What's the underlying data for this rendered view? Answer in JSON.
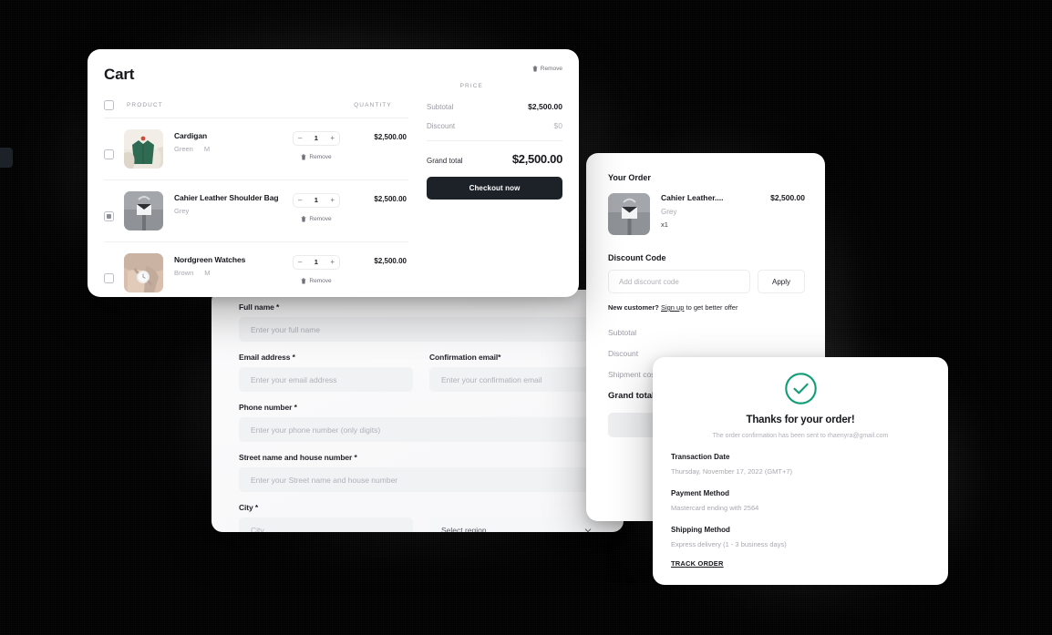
{
  "cart": {
    "title": "Cart",
    "remove_all_label": "Remove",
    "columns": {
      "select": "",
      "product": "PRODUCT",
      "quantity": "QUANTITY",
      "price": "PRICE"
    },
    "rows": [
      {
        "name": "Cardigan",
        "color": "Green",
        "size": "M",
        "qty": "1",
        "price": "$2,500.00",
        "selected": false,
        "remove_label": "Remove",
        "minus": "–",
        "plus": "+",
        "thumb": "cardigan-photo"
      },
      {
        "name": "Cahier Leather Shoulder Bag",
        "color": "Grey",
        "size": "",
        "qty": "1",
        "price": "$2,500.00",
        "selected": true,
        "remove_label": "Remove",
        "minus": "–",
        "plus": "+",
        "thumb": "bag-photo"
      },
      {
        "name": "Nordgreen Watches",
        "color": "Brown",
        "size": "M",
        "qty": "1",
        "price": "$2,500.00",
        "selected": false,
        "remove_label": "Remove",
        "minus": "–",
        "plus": "+",
        "thumb": "watch-photo"
      }
    ],
    "summary": {
      "subtotal_label": "Subtotal",
      "subtotal_value": "$2,500.00",
      "discount_label": "Discount",
      "discount_value": "$0",
      "grand_total_label": "Grand total",
      "grand_total_value": "$2,500.00",
      "checkout_label": "Checkout now"
    }
  },
  "checkout_form": {
    "fields": [
      {
        "label": "Full name *",
        "placeholder": "Enter your full name",
        "value": ""
      },
      {
        "label": "Email address *",
        "placeholder": "Enter your email address",
        "value": ""
      },
      {
        "label": "Confirmation email*",
        "placeholder": "Enter your confirmation email",
        "value": ""
      },
      {
        "label": "Phone number *",
        "placeholder": "Enter your phone number (only digits)",
        "value": ""
      },
      {
        "label": "Street name and house number *",
        "placeholder": "Enter your Street name and house number",
        "value": ""
      },
      {
        "label": "City *",
        "placeholder": "City",
        "value": ""
      }
    ],
    "region_select": {
      "selected": "Select region",
      "icon": "chevron-down-icon"
    }
  },
  "order": {
    "title": "Your Order",
    "item": {
      "name": "Cahier Leather....",
      "variant": "Grey",
      "quantity": "x1",
      "price": "$2,500.00",
      "thumb": "bag-photo"
    },
    "discount_code": {
      "title": "Discount Code",
      "placeholder": "Add discount code",
      "value": "",
      "apply_label": "Apply"
    },
    "new_customer": {
      "lead": "New customer?",
      "link": "Sign up",
      "tail": "to get better offer"
    },
    "summary": {
      "subtotal_label": "Subtotal",
      "discount_label": "Discount",
      "shipment_label": "Shipment cost",
      "grand_total_label": "Grand total"
    }
  },
  "confirmation": {
    "check_icon": "success-check-icon",
    "accent_color": "#0f9d76",
    "title": "Thanks for your order!",
    "subtitle": "The order confirmation has been sent to rhaenyra@gmail.com",
    "blocks": [
      {
        "label": "Transaction Date",
        "value": "Thursday, November 17, 2022 (GMT+7)"
      },
      {
        "label": "Payment Method",
        "value": "Mastercard ending with 2564"
      },
      {
        "label": "Shipping Method",
        "value": "Express delivery (1 - 3 business days)"
      }
    ],
    "track_label": "TRACK ORDER"
  }
}
